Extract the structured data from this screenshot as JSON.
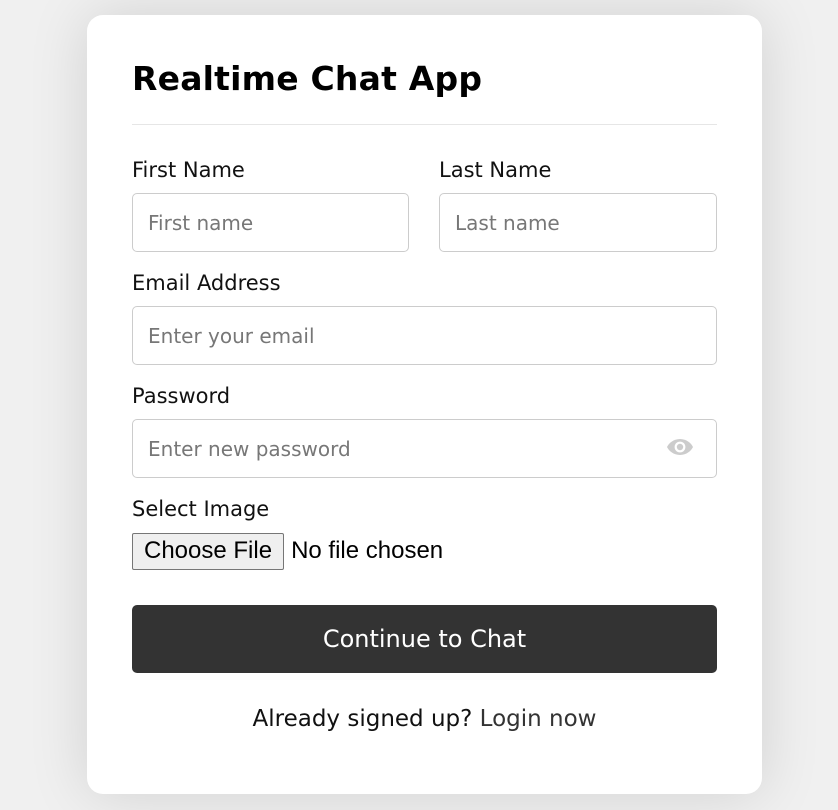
{
  "header": {
    "title": "Realtime Chat App"
  },
  "form": {
    "first_name": {
      "label": "First Name",
      "placeholder": "First name",
      "value": ""
    },
    "last_name": {
      "label": "Last Name",
      "placeholder": "Last name",
      "value": ""
    },
    "email": {
      "label": "Email Address",
      "placeholder": "Enter your email",
      "value": ""
    },
    "password": {
      "label": "Password",
      "placeholder": "Enter new password",
      "value": "",
      "toggle_icon": "eye-icon"
    },
    "image": {
      "label": "Select Image",
      "button_label": "Choose File",
      "status": "No file chosen"
    },
    "submit_label": "Continue to Chat"
  },
  "footer": {
    "prompt": "Already signed up?",
    "link_label": "Login now"
  },
  "colors": {
    "page_background": "#f0f0f0",
    "card_background": "#ffffff",
    "button_background": "#333333",
    "button_text": "#ffffff",
    "input_border": "#cccccc",
    "placeholder": "#777777"
  }
}
